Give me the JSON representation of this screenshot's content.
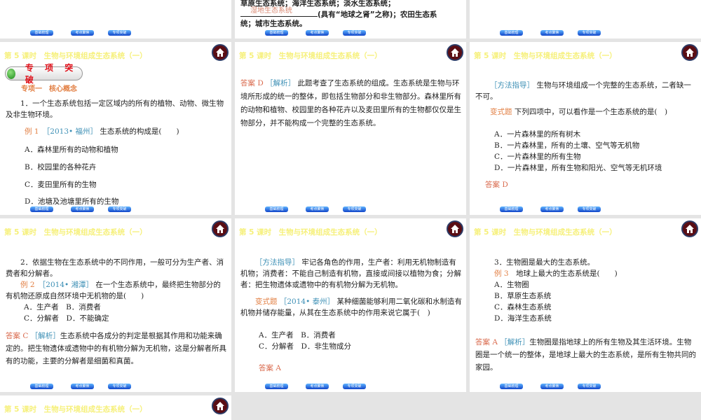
{
  "header_title": "第 5 课时　生物与环境组成生态系统（一）",
  "nav": [
    "基础梳理",
    "考点聚焦",
    "专项突破"
  ],
  "s0b": {
    "line1": "草原生态系统；海洋生态系统；淡水生态系统；",
    "fill": "湿地生态系统",
    "line2": "(具有“地球之肾”之称)；农田生态系",
    "line3": "统；城市生态系统。"
  },
  "s1a": {
    "badge": "专 项 突 破",
    "sub": "专项一　核心概念",
    "p1": "1．一个生态系统包括一定区域内的所有的植物、动物、微生物及非生物环境。",
    "ex": "例 1",
    "src": "［2013• 福州］",
    "q": "生态系统的构成是(　　)",
    "opts": [
      "A．森林里所有的动物和植物",
      "B．校园里的各种花卉",
      "C．麦田里所有的生物",
      "D．池塘及池塘里所有的生物"
    ]
  },
  "s1b": {
    "ans": "答案 D",
    "tag": "［解析］",
    "text": "此题考查了生态系统的组成。生态系统是生物与环境所形成的统一的整体，即包括生物部分和非生物部分。森林里所有的动物和植物、校园里的各种花卉以及麦田里所有的生物都仅仅是生物部分，并不能构成一个完整的生态系统。"
  },
  "s1c": {
    "tag": "［方法指导］",
    "text": "生物与环境组成一个完整的生态系统，二者缺一不可。",
    "var": "变式题",
    "q": "下列四项中，可以看作是一个生态系统的是(　)",
    "opts": [
      "A．一片森林里的所有树木",
      "B．一片森林里，所有的土壤、空气等无机物",
      "C．一片森林里的所有生物",
      "D．一片森林里，所有生物和阳光、空气等无机环境"
    ],
    "ans": "答案 D"
  },
  "s2a": {
    "p": "2．依据生物在生态系统中的不同作用，一般可分为生产者、消费者和分解者。",
    "ex": "例 2",
    "src": "［2014• 湘潭］",
    "q": "在一个生态系统中，最终把生物部分的有机物还原成自然环境中无机物的是(　　)",
    "o1": "A．生产者　B．消费者",
    "o2": "C．分解者　D．不能确定",
    "ans": "答案 C",
    "tag": "［解析］",
    "text": "生态系统中各成分的判定是根据其作用和功能来确定的。把生物遗体或遗物中的有机物分解为无机物，这是分解者所具有的功能，主要的分解者是细菌和真菌。"
  },
  "s2b": {
    "tag": "［方法指导］",
    "text": "牢记各角色的作用，生产者：利用无机物制造有机物；消费者：不能自己制造有机物，直接或间接以植物为食；分解者：把生物遗体或遗物中的有机物分解为无机物。",
    "var": "变式题",
    "src": "［2014• 泰州］",
    "q": "某种细菌能够利用二氧化碳和水制造有机物并储存能量，从其在生态系统中的作用来说它属于(　)",
    "o1": "A．生产者　B．消费者",
    "o2": "C．分解者　D．非生物成分",
    "ans": "答案 A"
  },
  "s2c": {
    "p": "3．生物圈是最大的生态系统。",
    "ex": "例 3",
    "q": "地球上最大的生态系统是(　　)",
    "opts": [
      "A．生物圈",
      "B．草原生态系统",
      "C．森林生态系统",
      "D．海洋生态系统"
    ],
    "ans": "答案 A",
    "tag": "［解析］",
    "text": "生物圈是指地球上的所有生物及其生活环境。生物圈是一个统一的整体，是地球上最大的生态系统，是所有生物共同的家园。"
  }
}
